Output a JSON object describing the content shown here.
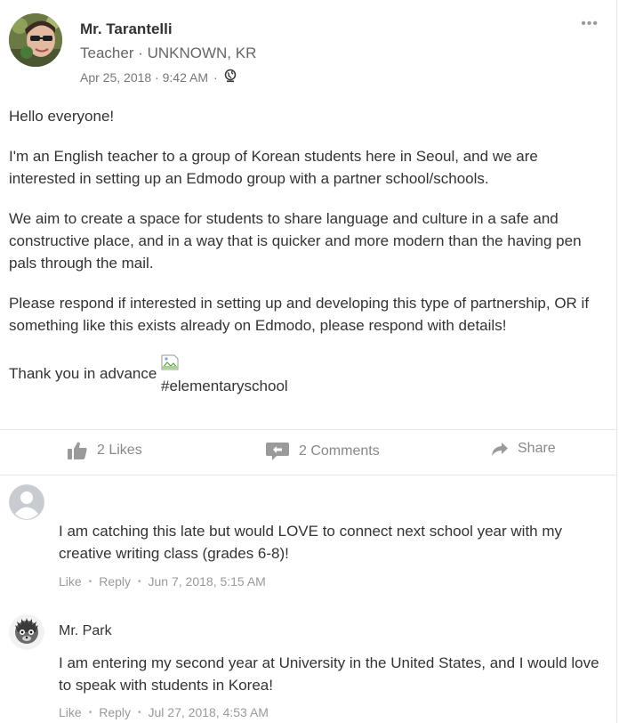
{
  "post": {
    "author": "Mr. Tarantelli",
    "role": "Teacher · UNKNOWN, KR",
    "timestamp": "Apr 25, 2018 · 9:42 AM",
    "meta_separator": "·",
    "visibility_icon": "globe-icon",
    "menu_glyph": "•••",
    "paragraphs": [
      "Hello everyone!",
      "I'm an English teacher to a group of Korean students here in Seoul, and we are interested in setting up an Edmodo group with a partner school/schools.",
      "We aim to create a space for students to share language and culture in a safe and constructive place, and in a way that is quicker and more modern than the having pen pals through the mail.",
      "Please respond if interested in setting up and developing this type of partnership, OR if something like this exists already on Edmodo, please respond with details!"
    ],
    "closing": "Thank you in advance",
    "hashtag": "#elementaryschool"
  },
  "actions": {
    "likes": "2 Likes",
    "comments": "2 Comments",
    "share": "Share"
  },
  "comments": [
    {
      "author": "",
      "text": "I am catching this late but would LOVE to connect next school year with my creative writing class (grades 6-8)!",
      "like": "Like",
      "reply": "Reply",
      "timestamp": "Jun 7, 2018, 5:15 AM",
      "separator": "•"
    },
    {
      "author": "Mr. Park",
      "text": "I am entering my second year at University in the United States, and I would love to speak with students in Korea!",
      "like": "Like",
      "reply": "Reply",
      "timestamp": "Jul 27, 2018, 4:53 AM",
      "separator": "•"
    }
  ],
  "colors": {
    "text": "#333333",
    "muted": "#888888",
    "divider": "#e8e8e8"
  }
}
